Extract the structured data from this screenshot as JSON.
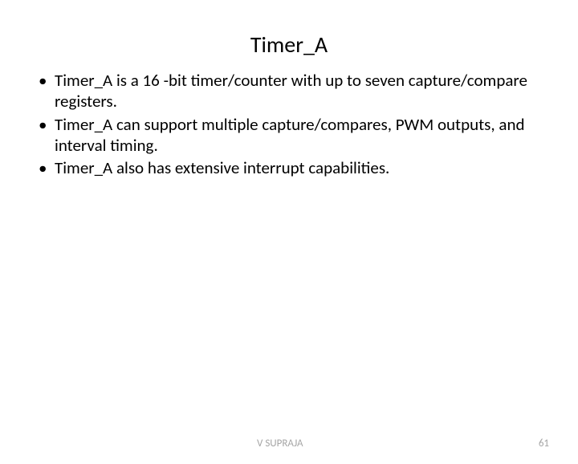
{
  "slide": {
    "title": "Timer_A",
    "bullets": [
      "Timer_A is a 16 -bit timer/counter with up to seven capture/compare registers.",
      "Timer_A can support multiple capture/compares, PWM outputs, and interval timing.",
      "Timer_A also has extensive interrupt capabilities."
    ],
    "footer": {
      "author": "V SUPRAJA",
      "page": "61"
    }
  }
}
